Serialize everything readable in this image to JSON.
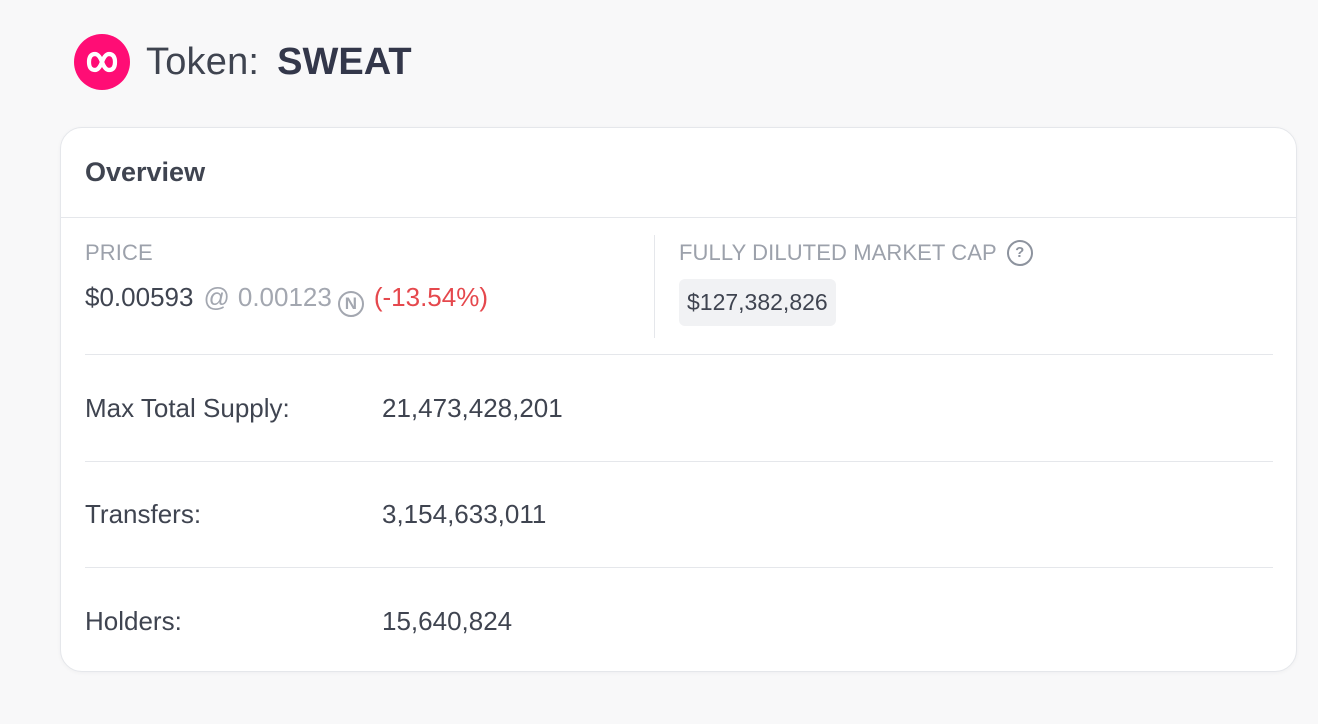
{
  "header": {
    "prefix": "Token:",
    "name": "SWEAT",
    "logo_color": "#ff0d75",
    "logo_icon": "sweat-logo-icon"
  },
  "overview": {
    "title": "Overview",
    "price": {
      "label": "PRICE",
      "usd": "$0.00593",
      "at": "@",
      "near": "0.00123",
      "near_icon": "Ⓝ",
      "change": "(-13.54%)",
      "change_color": "#e5484d"
    },
    "market_cap": {
      "label": "FULLY DILUTED MARKET CAP",
      "help_icon": "?",
      "value": "$127,382,826"
    },
    "rows": [
      {
        "label": "Max Total Supply:",
        "value": "21,473,428,201"
      },
      {
        "label": "Transfers:",
        "value": "3,154,633,011"
      },
      {
        "label": "Holders:",
        "value": "15,640,824"
      }
    ]
  }
}
